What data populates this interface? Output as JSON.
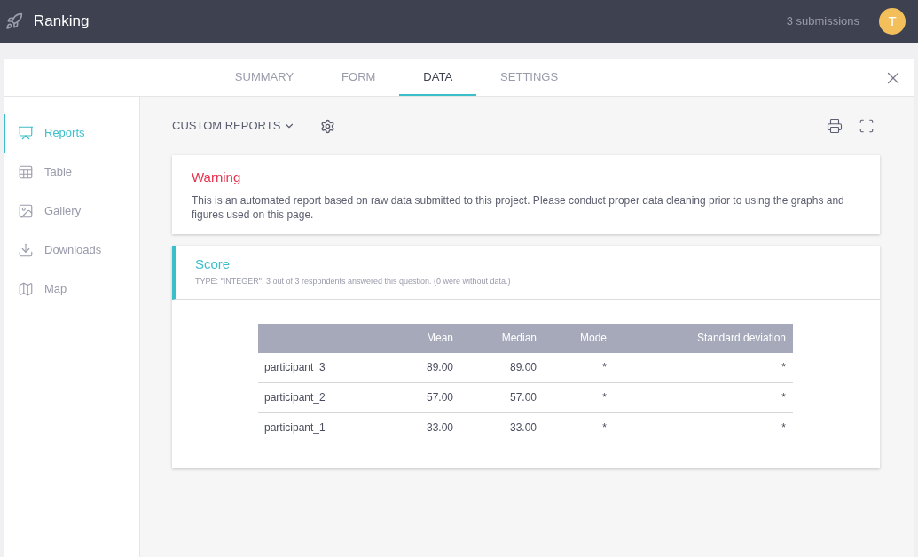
{
  "header": {
    "title": "Ranking",
    "submissions": "3 submissions",
    "avatar": "T"
  },
  "tabs": [
    {
      "label": "SUMMARY",
      "selected": false
    },
    {
      "label": "FORM",
      "selected": false
    },
    {
      "label": "DATA",
      "selected": true
    },
    {
      "label": "SETTINGS",
      "selected": false
    }
  ],
  "sidebar": {
    "items": [
      {
        "label": "Reports",
        "kind": "reports",
        "selected": true
      },
      {
        "label": "Table",
        "kind": "table",
        "selected": false
      },
      {
        "label": "Gallery",
        "kind": "gallery",
        "selected": false
      },
      {
        "label": "Downloads",
        "kind": "downloads",
        "selected": false
      },
      {
        "label": "Map",
        "kind": "map",
        "selected": false
      }
    ]
  },
  "toolbar": {
    "custom_reports": "CUSTOM REPORTS"
  },
  "warning": {
    "title": "Warning",
    "text": "This is an automated report based on raw data submitted to this project. Please conduct proper data cleaning prior to using the graphs and figures used on this page."
  },
  "question": {
    "title": "Score",
    "subtitle": "TYPE: \"INTEGER\". 3 out of 3 respondents answered this question. (0 were without data.)"
  },
  "table": {
    "columns": [
      "",
      "Mean",
      "Median",
      "Mode",
      "Standard deviation"
    ],
    "rows": [
      [
        "participant_3",
        "89.00",
        "89.00",
        "*",
        "*"
      ],
      [
        "participant_2",
        "57.00",
        "57.00",
        "*",
        "*"
      ],
      [
        "participant_1",
        "33.00",
        "33.00",
        "*",
        "*"
      ]
    ]
  }
}
